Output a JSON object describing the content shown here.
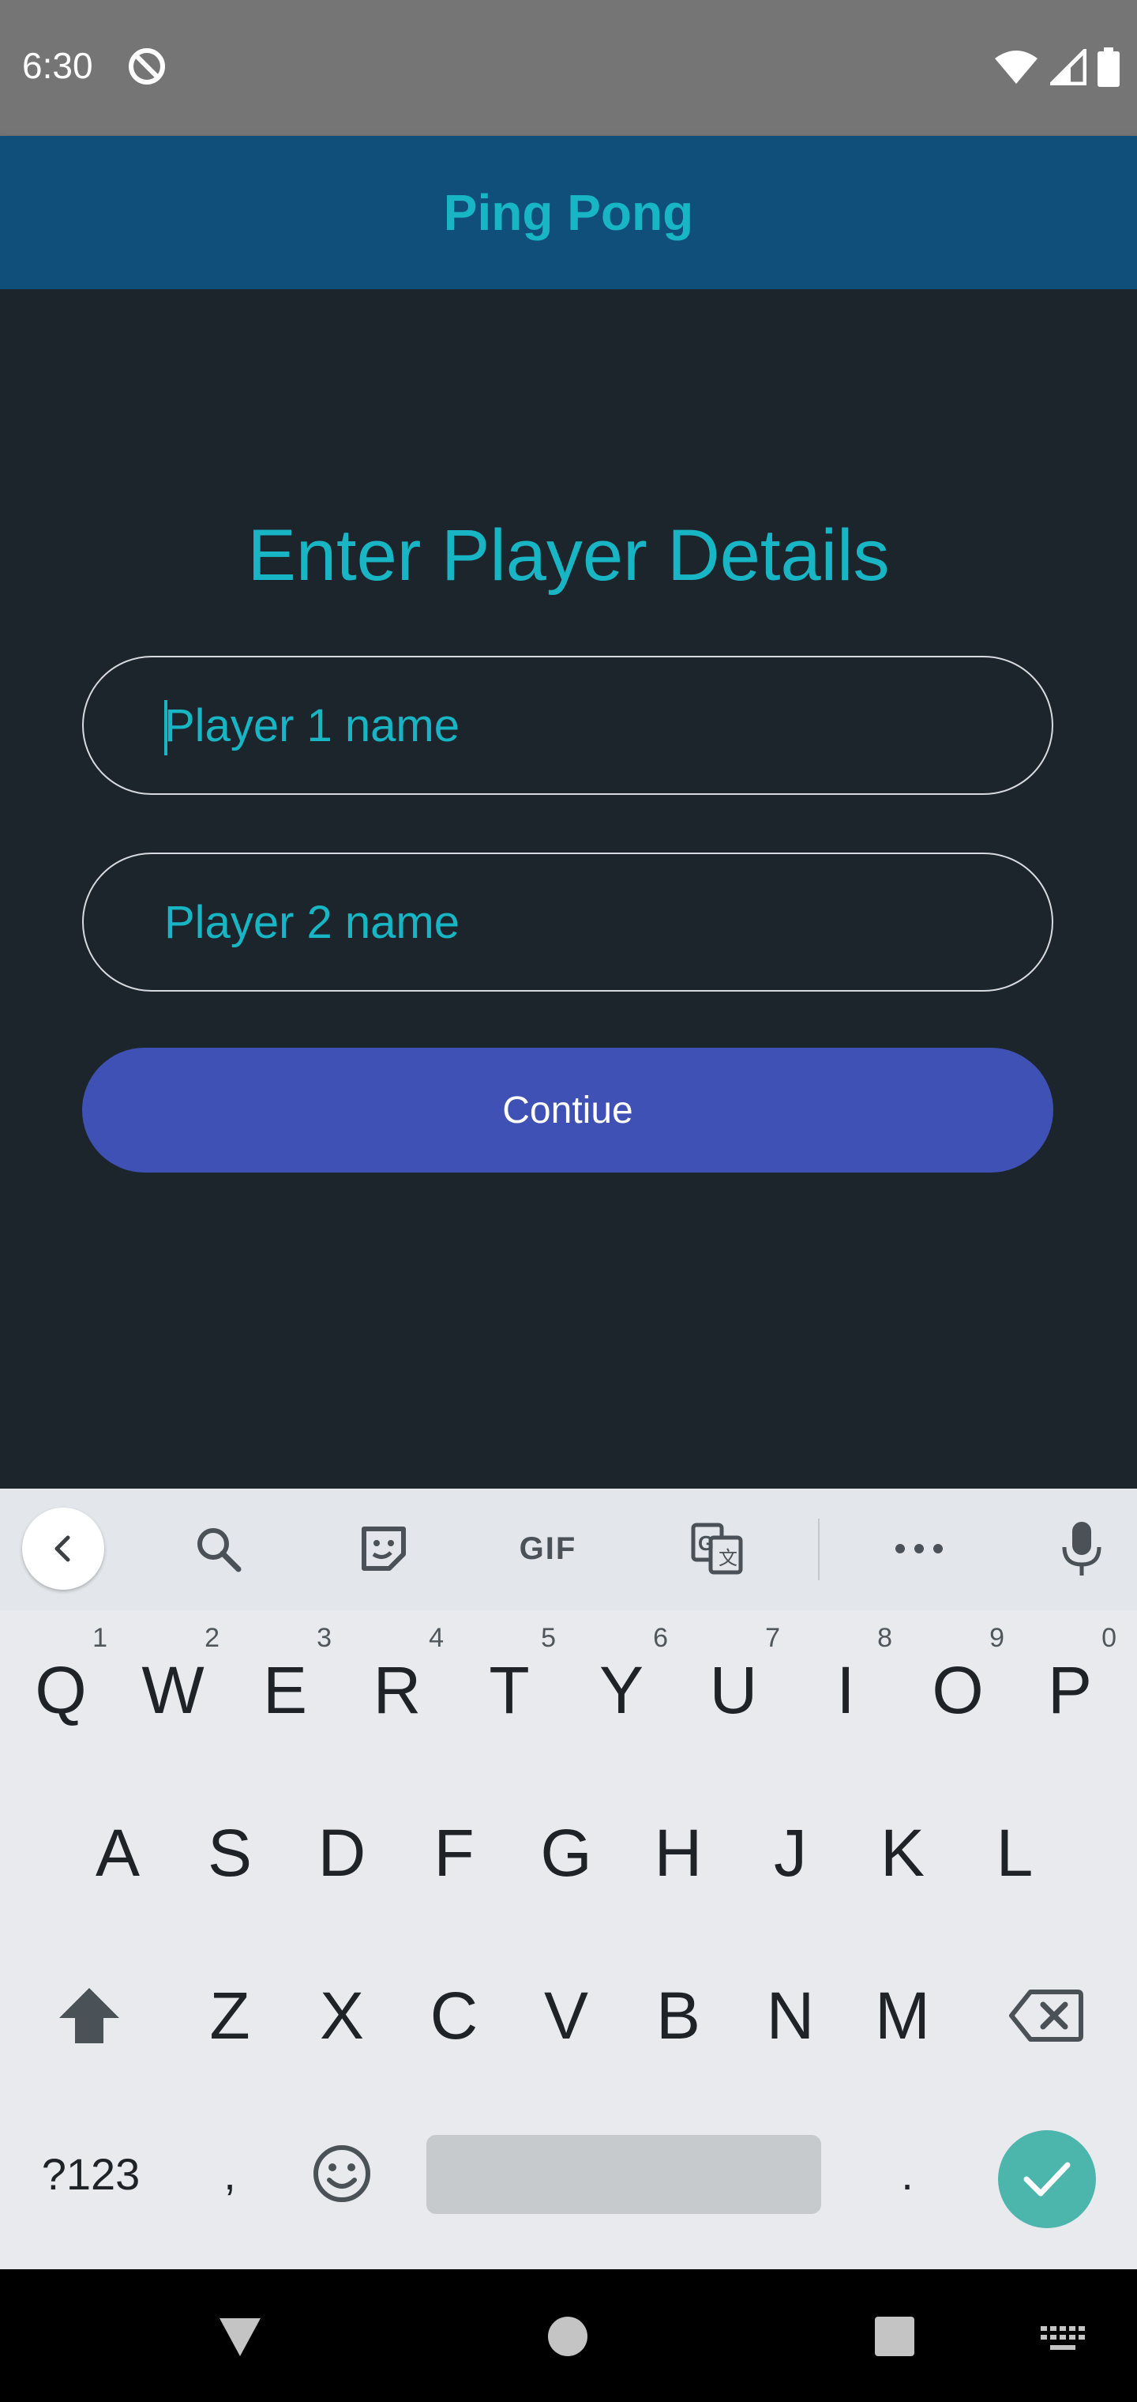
{
  "status_bar": {
    "time": "6:30"
  },
  "app_bar": {
    "title": "Ping Pong"
  },
  "form": {
    "heading": "Enter Player Details",
    "player1_placeholder": "Player 1 name",
    "player1_value": "",
    "player2_placeholder": "Player 2 name",
    "player2_value": "",
    "continue_label": "Contiue"
  },
  "keyboard": {
    "toolbar": {
      "gif_label": "GIF"
    },
    "row1": [
      {
        "key": "Q",
        "hint": "1"
      },
      {
        "key": "W",
        "hint": "2"
      },
      {
        "key": "E",
        "hint": "3"
      },
      {
        "key": "R",
        "hint": "4"
      },
      {
        "key": "T",
        "hint": "5"
      },
      {
        "key": "Y",
        "hint": "6"
      },
      {
        "key": "U",
        "hint": "7"
      },
      {
        "key": "I",
        "hint": "8"
      },
      {
        "key": "O",
        "hint": "9"
      },
      {
        "key": "P",
        "hint": "0"
      }
    ],
    "row2": [
      "A",
      "S",
      "D",
      "F",
      "G",
      "H",
      "J",
      "K",
      "L"
    ],
    "row3": [
      "Z",
      "X",
      "C",
      "V",
      "B",
      "N",
      "M"
    ],
    "row4": {
      "symbols_label": "?123",
      "comma": ",",
      "period": "."
    }
  },
  "colors": {
    "accent": "#18b5c4",
    "app_bar": "#0f4f7a",
    "background": "#1d252c",
    "button": "#3f51b5",
    "enter": "#4db6ac"
  }
}
